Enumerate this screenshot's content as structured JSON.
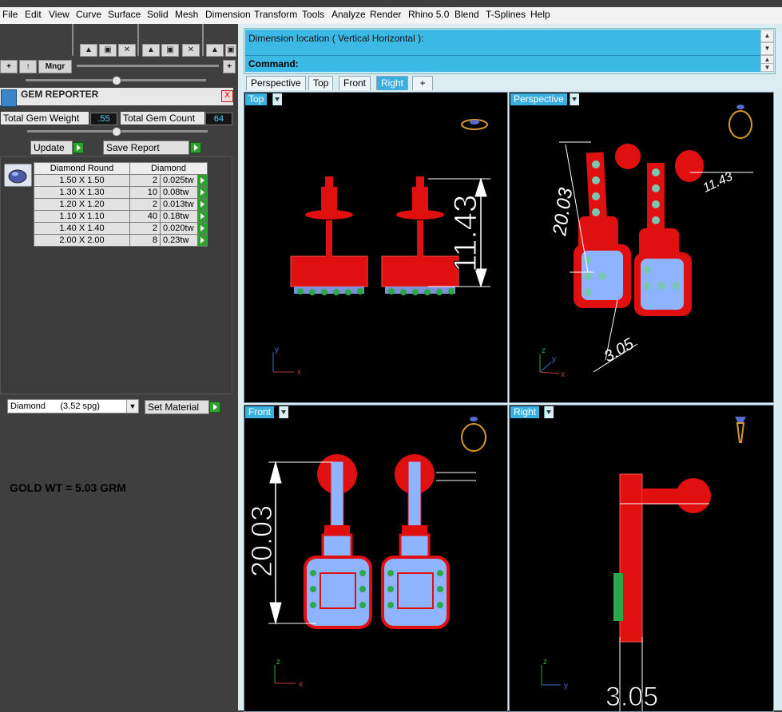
{
  "menu": [
    "File",
    "Edit",
    "View",
    "Curve",
    "Surface",
    "Solid",
    "Mesh",
    "Dimension",
    "Transform",
    "Tools",
    "Analyze",
    "Render",
    "Rhino 5.0",
    "Blend",
    "T-Splines",
    "Help"
  ],
  "toolbar": {
    "manager_label": "Mngr",
    "plus": "+",
    "up": "↑"
  },
  "gem_reporter": {
    "title": "GEM REPORTER",
    "close": "X",
    "total_weight_label": "Total Gem Weight",
    "total_weight_value": ".55",
    "total_count_label": "Total Gem Count",
    "total_count_value": "64",
    "update_label": "Update",
    "save_report_label": "Save Report",
    "table_headers": [
      "Diamond Round",
      "Diamond"
    ],
    "rows": [
      {
        "size": "1.50 X 1.50",
        "qty": "2",
        "weight": "0.025tw"
      },
      {
        "size": "1.30 X 1.30",
        "qty": "10",
        "weight": "0.08tw"
      },
      {
        "size": "1.20 X 1.20",
        "qty": "2",
        "weight": "0.013tw"
      },
      {
        "size": "1.10 X 1.10",
        "qty": "40",
        "weight": "0.18tw"
      },
      {
        "size": "1.40 X 1.40",
        "qty": "2",
        "weight": "0.020tw"
      },
      {
        "size": "2.00 X 2.00",
        "qty": "8",
        "weight": "0.23tw"
      }
    ],
    "material_value": "Diamond      (3.52 spg)",
    "set_material_label": "Set Material"
  },
  "gold_weight": "GOLD WT = 5.03 GRM",
  "command": {
    "prompt": "Dimension location ( Vertical  Horizontal ):",
    "label": "Command:"
  },
  "viewport_tabs": [
    "Perspective",
    "Top",
    "Front",
    "Right",
    "+"
  ],
  "viewports": {
    "top": {
      "name": "Top",
      "dimension": "11.43"
    },
    "perspective": {
      "name": "Perspective",
      "dimension_a": "20.03",
      "dimension_b": "11.43",
      "dimension_c": "3.05"
    },
    "front": {
      "name": "Front",
      "dimension": "20.03"
    },
    "right": {
      "name": "Right",
      "dimension": "3.05"
    }
  },
  "axes": {
    "x": "x",
    "y": "y",
    "z": "z"
  },
  "colors": {
    "accent": "#3ab0e0",
    "metal": "#e01010",
    "gem": "#8fb4ff",
    "gem_edge": "#2aa84a"
  }
}
